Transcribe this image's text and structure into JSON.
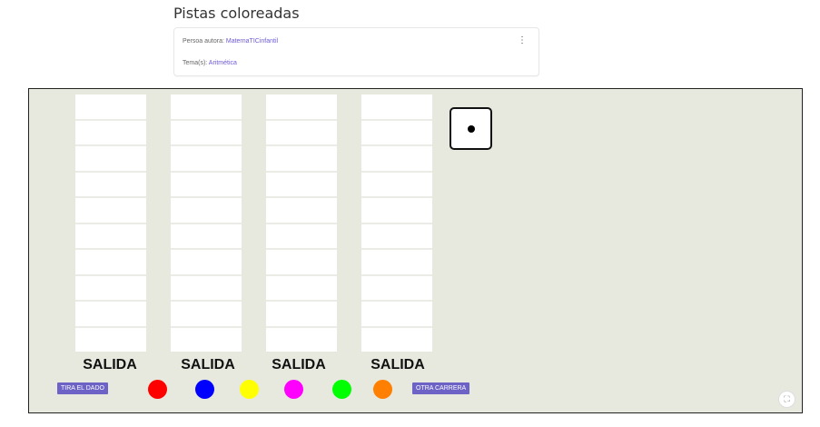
{
  "page": {
    "title": "Pistas coloreadas"
  },
  "info": {
    "author_label": "Persoa autora:",
    "author_value": "MaternaTICinfantil",
    "topic_label": "Tema(s):",
    "topic_value": "Aritmética",
    "menu_icon": "kebab-icon"
  },
  "board": {
    "tracks": [
      {
        "label": "SALIDA",
        "cells": 10
      },
      {
        "label": "SALIDA",
        "cells": 10
      },
      {
        "label": "SALIDA",
        "cells": 10
      },
      {
        "label": "SALIDA",
        "cells": 10
      }
    ],
    "die_value": 1,
    "roll_button": "TIRA EL DADO",
    "new_race_button": "OTRA CARRERA",
    "tokens": [
      {
        "name": "red",
        "color": "#ff0000"
      },
      {
        "name": "blue",
        "color": "#0000ff"
      },
      {
        "name": "yellow",
        "color": "#ffff00"
      },
      {
        "name": "magenta",
        "color": "#ff00ff"
      },
      {
        "name": "green",
        "color": "#00ff00"
      },
      {
        "name": "orange",
        "color": "#ff7f00"
      }
    ],
    "fullscreen_icon": "fullscreen-icon"
  }
}
